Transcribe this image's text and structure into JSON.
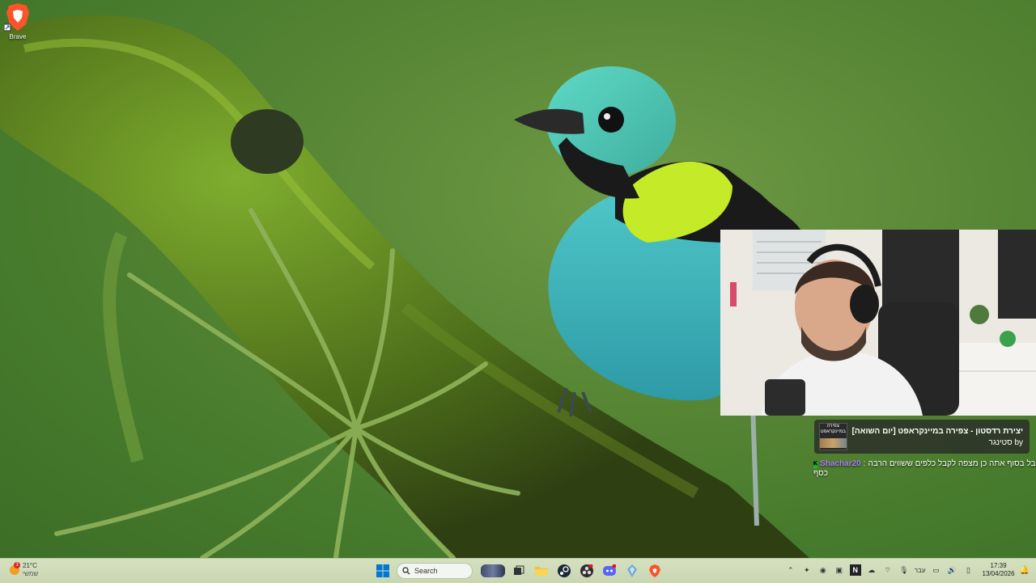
{
  "desktop": {
    "icons": [
      {
        "label": "Brave",
        "icon": "brave-lion-icon"
      }
    ]
  },
  "now_playing": {
    "title": "יצירת רדסטון - צפירה במיינקראפט [יום השואה]",
    "by": "by סטינגר",
    "thumb_text": "צפירה במיינקראפט"
  },
  "chat": {
    "badge": "K",
    "username": "Shachar20",
    "separator": ":",
    "message_part1": "אבל בסוף אתה כן מצפה לקבל כלפים ששווים הרבה",
    "message_part2": "כסף"
  },
  "taskbar": {
    "weather": {
      "temp": "21°C",
      "condition": "שמשי",
      "badge": "3"
    },
    "search_placeholder": "Search",
    "apps": [
      "windows-start-icon",
      "search-icon",
      "task-view-icon",
      "file-explorer-icon",
      "steam-icon",
      "obs-icon",
      "discord-icon",
      "app-icon",
      "brave-icon"
    ],
    "tray": {
      "language": "עבר",
      "time": "17:39",
      "date": "13/04/2026"
    },
    "colors": {
      "accent": "#0078d4",
      "brave": "#fb542b"
    }
  }
}
